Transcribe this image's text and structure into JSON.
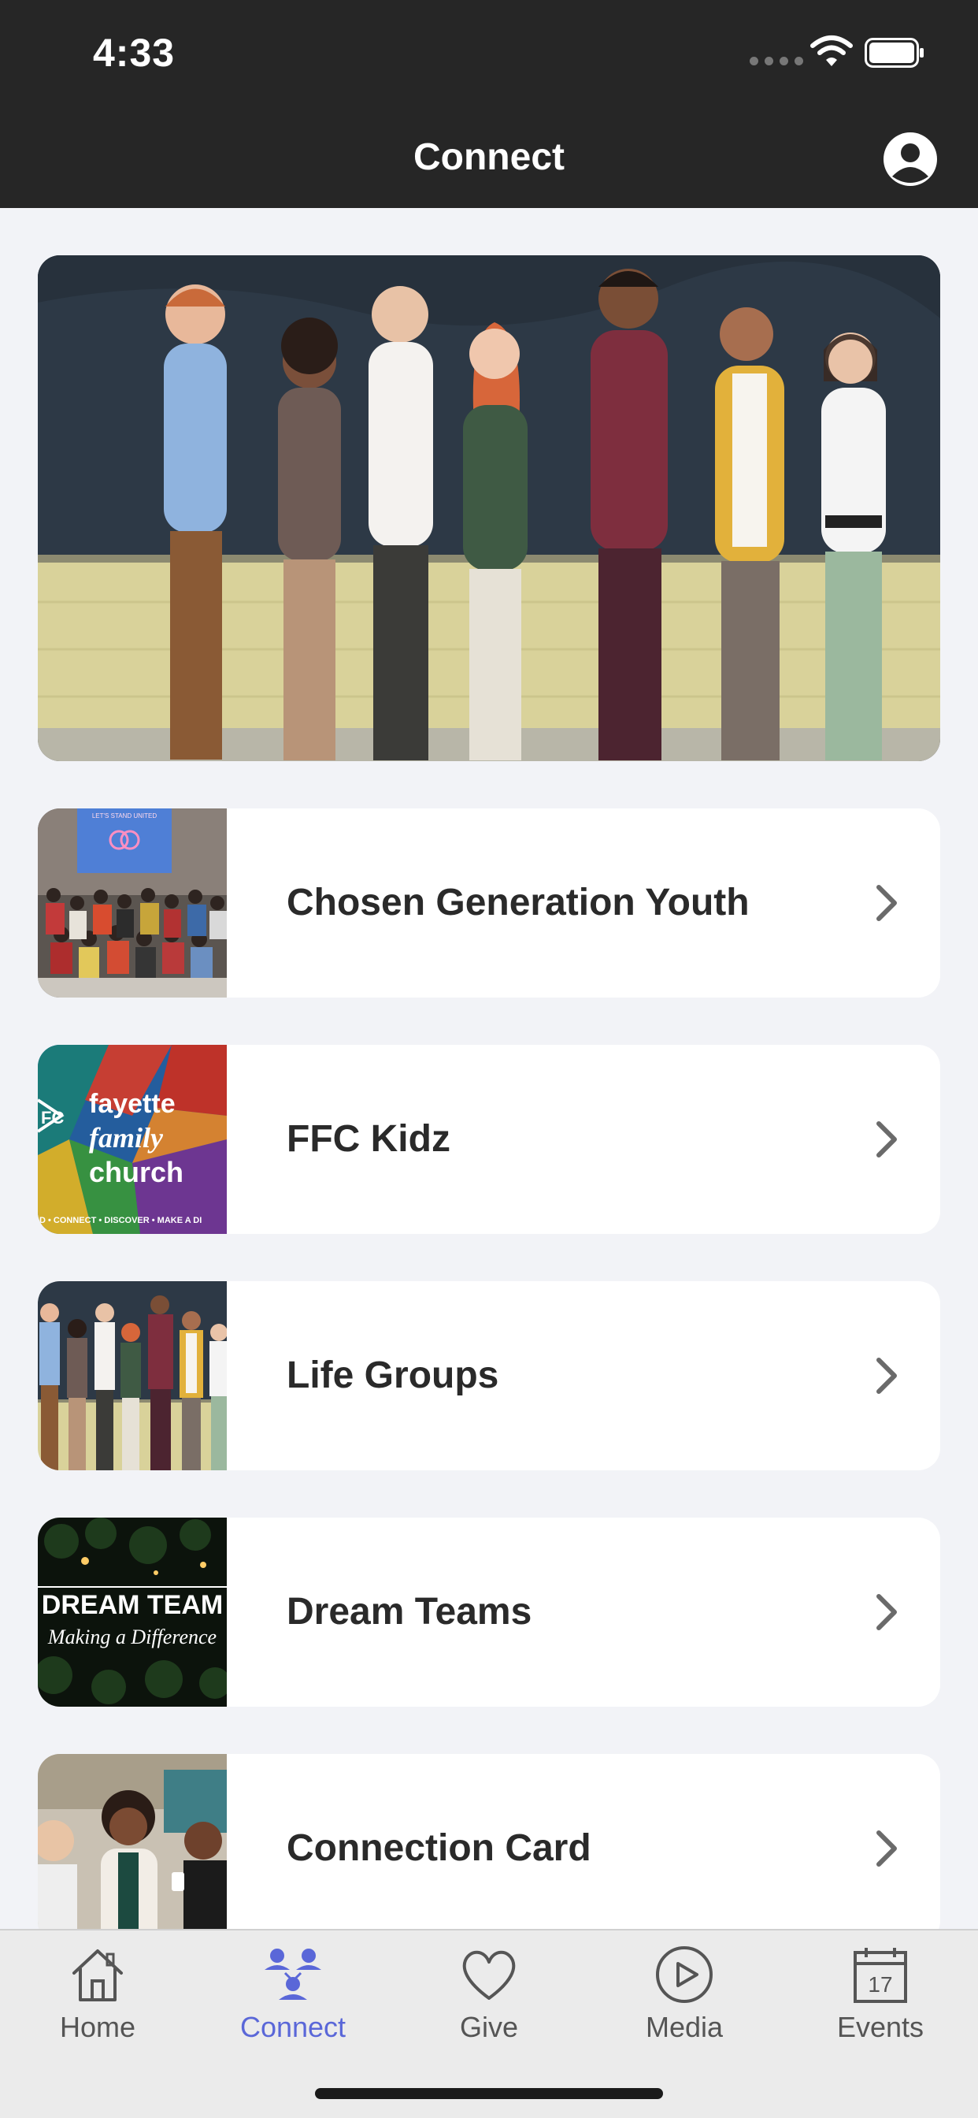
{
  "status_bar": {
    "time": "4:33"
  },
  "header": {
    "title": "Connect"
  },
  "cards": [
    {
      "label": "Chosen Generation Youth",
      "thumb": "youth-group-photo"
    },
    {
      "label": "FFC Kidz",
      "thumb": "ffc-logo-colorful"
    },
    {
      "label": "Life Groups",
      "thumb": "group-people-photo"
    },
    {
      "label": "Dream Teams",
      "thumb": "dream-team-sign"
    },
    {
      "label": "Connection Card",
      "thumb": "women-chatting-photo"
    }
  ],
  "thumb_text": {
    "ffc": [
      "fayette",
      "family",
      "church"
    ],
    "ffc_tagline": "D • CONNECT • DISCOVER • MAKE A DI",
    "dream_line1": "DREAM TEAM",
    "dream_line2": "Making a Difference",
    "youth_screen": "LET'S STAND UNITED"
  },
  "tabs": [
    {
      "label": "Home",
      "icon": "home-icon",
      "active": false
    },
    {
      "label": "Connect",
      "icon": "people-icon",
      "active": true
    },
    {
      "label": "Give",
      "icon": "heart-icon",
      "active": false
    },
    {
      "label": "Media",
      "icon": "play-icon",
      "active": false
    },
    {
      "label": "Events",
      "icon": "calendar-icon",
      "active": false,
      "badge": "17"
    }
  ],
  "colors": {
    "accent": "#5a67d8",
    "header_bg": "#262626",
    "page_bg": "#f2f3f7"
  }
}
